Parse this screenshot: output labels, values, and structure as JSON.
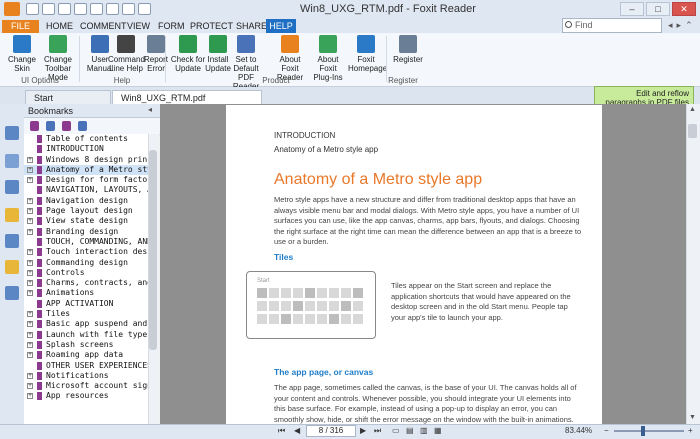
{
  "window": {
    "title": "Win8_UXG_RTM.pdf - Foxit Reader",
    "minimize": "–",
    "maximize": "□",
    "close": "✕"
  },
  "ribbon_tabs": [
    "FILE",
    "HOME",
    "COMMENT",
    "VIEW",
    "FORM",
    "PROTECT",
    "SHARE",
    "HELP"
  ],
  "active_tab": "HELP",
  "search": {
    "placeholder": "Find"
  },
  "ribbon": {
    "buttons": [
      {
        "label": "Change Skin",
        "icon": "skin-icon",
        "color": "#2a7ac7"
      },
      {
        "label": "Change Toolbar Mode",
        "icon": "toolbar-mode-icon",
        "color": "#3aa35a"
      },
      {
        "label": "User Manual",
        "icon": "manual-icon",
        "color": "#3c6fb6"
      },
      {
        "label": "Command Line Help",
        "icon": "command-line-icon",
        "color": "#444444"
      },
      {
        "label": "Report Error",
        "icon": "report-icon",
        "color": "#6a7f96"
      },
      {
        "label": "Check for Update",
        "icon": "update-check-icon",
        "color": "#2e9a4f"
      },
      {
        "label": "Install Update",
        "icon": "install-update-icon",
        "color": "#2e9a4f"
      },
      {
        "label": "Set to Default PDF Reader",
        "icon": "default-reader-icon",
        "color": "#4a72b8"
      },
      {
        "label": "About Foxit Reader",
        "icon": "foxit-logo-icon",
        "color": "#e8821e"
      },
      {
        "label": "About Foxit Plug-Ins",
        "icon": "plugin-icon",
        "color": "#3aa35a"
      },
      {
        "label": "Foxit Homepage",
        "icon": "globe-icon",
        "color": "#2a7ac7"
      },
      {
        "label": "Register",
        "icon": "register-icon",
        "color": "#6a7f96"
      }
    ],
    "groups": [
      "UI Options",
      "Help",
      "Product",
      "Register"
    ]
  },
  "doc_tabs": [
    "Start",
    "Win8_UXG_RTM.pdf"
  ],
  "reflow_hint": "Edit and reflow paragraphs in PDF files",
  "bookmarks": {
    "title": "Bookmarks",
    "items": [
      {
        "label": "Table of contents",
        "expandable": false
      },
      {
        "label": "INTRODUCTION",
        "expandable": false
      },
      {
        "label": "Windows 8 design principles",
        "expandable": true
      },
      {
        "label": "Anatomy of a Metro style app",
        "expandable": true,
        "selected": true
      },
      {
        "label": "Design for form factors",
        "expandable": true
      },
      {
        "label": "NAVIGATION, LAYOUTS, AND VI",
        "expandable": false
      },
      {
        "label": "Navigation design",
        "expandable": true
      },
      {
        "label": "Page layout design",
        "expandable": true
      },
      {
        "label": "View state design",
        "expandable": true
      },
      {
        "label": "Branding design",
        "expandable": true
      },
      {
        "label": "TOUCH, COMMANDING, AND CO",
        "expandable": false
      },
      {
        "label": "Touch interaction design",
        "expandable": true
      },
      {
        "label": "Commanding design",
        "expandable": true
      },
      {
        "label": "Controls",
        "expandable": true
      },
      {
        "label": "Charms, contracts, and devices",
        "expandable": true
      },
      {
        "label": "Animations",
        "expandable": true
      },
      {
        "label": "APP ACTIVATION",
        "expandable": false
      },
      {
        "label": "Tiles",
        "expandable": true
      },
      {
        "label": "Basic app suspend and resume",
        "expandable": true
      },
      {
        "label": "Launch with file types and proto",
        "expandable": true
      },
      {
        "label": "Splash screens",
        "expandable": true
      },
      {
        "label": "Roaming app data",
        "expandable": true
      },
      {
        "label": "OTHER USER EXPERIENCES",
        "expandable": false
      },
      {
        "label": "Notifications",
        "expandable": true
      },
      {
        "label": "Microsoft account sign-in",
        "expandable": true
      },
      {
        "label": "App resources",
        "expandable": true
      }
    ]
  },
  "page": {
    "section": "INTRODUCTION",
    "subsection": "Anatomy of a Metro style app",
    "heading": "Anatomy of a Metro style app",
    "intro": "Metro style apps have a new structure and differ from traditional desktop apps that have an always visible menu bar and modal dialogs. With Metro style apps, you have a number of UI surfaces you can use, like the app canvas, charms, app bars, flyouts, and dialogs. Choosing the right surface at the right time can mean the difference between an app that is a breeze to use or a burden.",
    "tiles_heading": "Tiles",
    "tiles_fig_label": "Start",
    "tiles_text": "Tiles appear on the Start screen and replace the application shortcuts that would have appeared on the desktop screen and in the old Start menu. People tap your app's tile to launch your app.",
    "canvas_heading": "The app page, or canvas",
    "canvas_text": "The app page, sometimes called the canvas, is the base of your UI. The canvas holds all of your content and controls. Whenever possible, you should integrate your UI elements into this base surface. For example, instead of using a pop-up to display an error, you can smoothly show, hide, or shift the error message on the window with the built-in animations. Presenting your UI"
  },
  "status": {
    "page_display": "8 / 316",
    "zoom": "83.44%"
  }
}
